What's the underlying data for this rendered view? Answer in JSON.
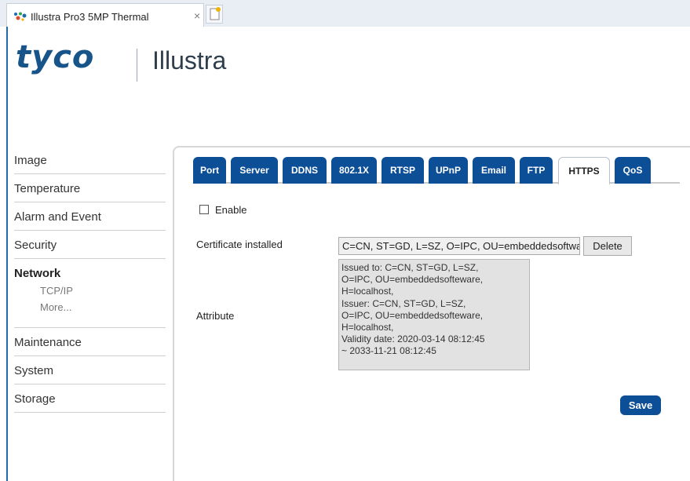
{
  "browser": {
    "tab_title": "Illustra Pro3 5MP Thermal",
    "close_glyph": "×",
    "favicon": "illustra-favicon-icon",
    "new_tab_icon": "new-tab-icon"
  },
  "logo": {
    "brand": "tyco",
    "product": "Illustra",
    "brand_color": "#17548a"
  },
  "sidebar": {
    "items": [
      {
        "label": "Image"
      },
      {
        "label": "Temperature"
      },
      {
        "label": "Alarm and Event"
      },
      {
        "label": "Security"
      }
    ],
    "network": {
      "label": "Network",
      "subitems": [
        {
          "label": "TCP/IP"
        },
        {
          "label": "More..."
        }
      ]
    },
    "items_after": [
      {
        "label": "Maintenance"
      },
      {
        "label": "System"
      },
      {
        "label": "Storage"
      }
    ]
  },
  "tabs": [
    {
      "label": "Port"
    },
    {
      "label": "Server"
    },
    {
      "label": "DDNS"
    },
    {
      "label": "802.1X"
    },
    {
      "label": "RTSP"
    },
    {
      "label": "UPnP"
    },
    {
      "label": "Email"
    },
    {
      "label": "FTP"
    },
    {
      "label": "HTTPS",
      "active": true
    },
    {
      "label": "QoS"
    }
  ],
  "https": {
    "enable_label": "Enable",
    "enable_checked": false,
    "certificate_label": "Certificate installed",
    "certificate_value": "C=CN, ST=GD, L=SZ, O=IPC, OU=embeddedsoftware, H=localhost",
    "delete_label": "Delete",
    "attribute_label": "Attribute",
    "attribute_lines": [
      "Issued to: C=CN, ST=GD, L=SZ,",
      "O=IPC, OU=embeddedsofteware,",
      "H=localhost,",
      "Issuer: C=CN, ST=GD, L=SZ,",
      "O=IPC, OU=embeddedsofteware,",
      "H=localhost,",
      "Validity date: 2020-03-14 08:12:45",
      "~ 2033-11-21 08:12:45"
    ],
    "save_label": "Save"
  },
  "colors": {
    "accent": "#0d4f97",
    "frame": "#1f6aa8"
  }
}
